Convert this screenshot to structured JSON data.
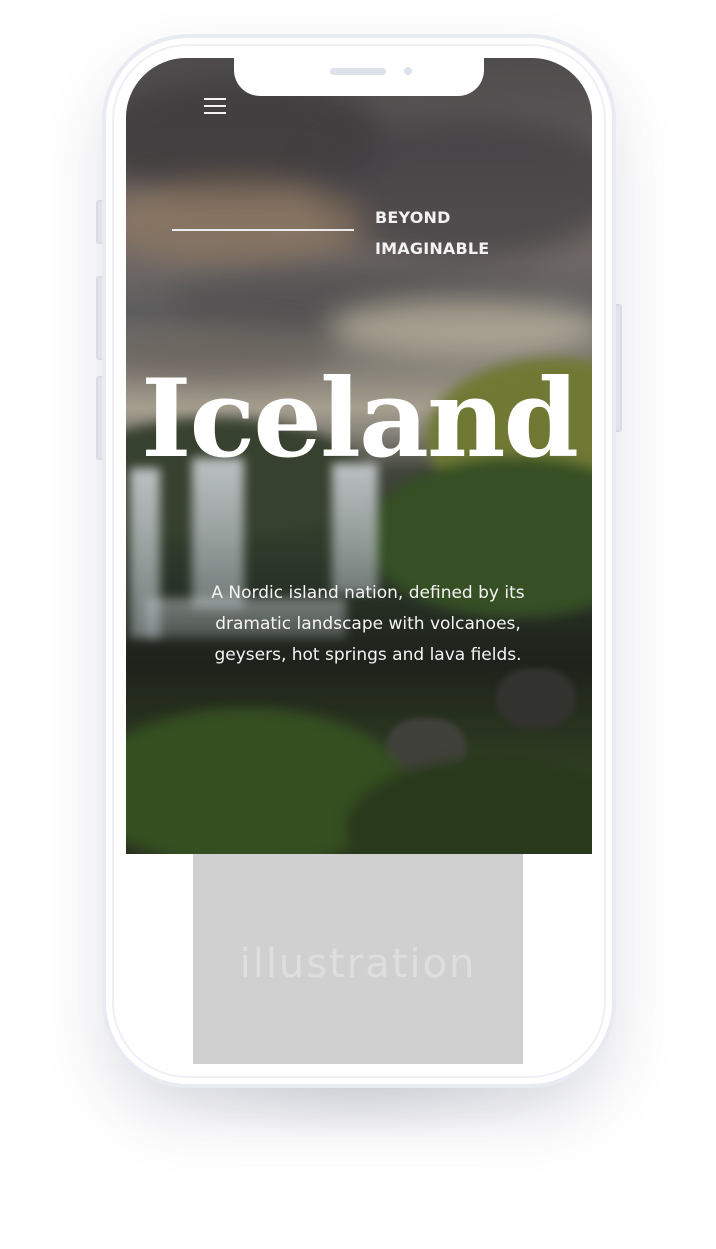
{
  "hero": {
    "tagline_line1": "BEYOND",
    "tagline_line2": "IMAGINABLE",
    "title": "Iceland",
    "description": "A Nordic island nation, defined by its dramatic landscape with volcanoes, geysers, hot springs and lava fields."
  },
  "illustration": {
    "label": "illustration"
  },
  "icons": {
    "menu": "hamburger-menu-icon"
  },
  "colors": {
    "placeholder_bg": "#d0d0d0",
    "text_light": "#ffffff"
  }
}
